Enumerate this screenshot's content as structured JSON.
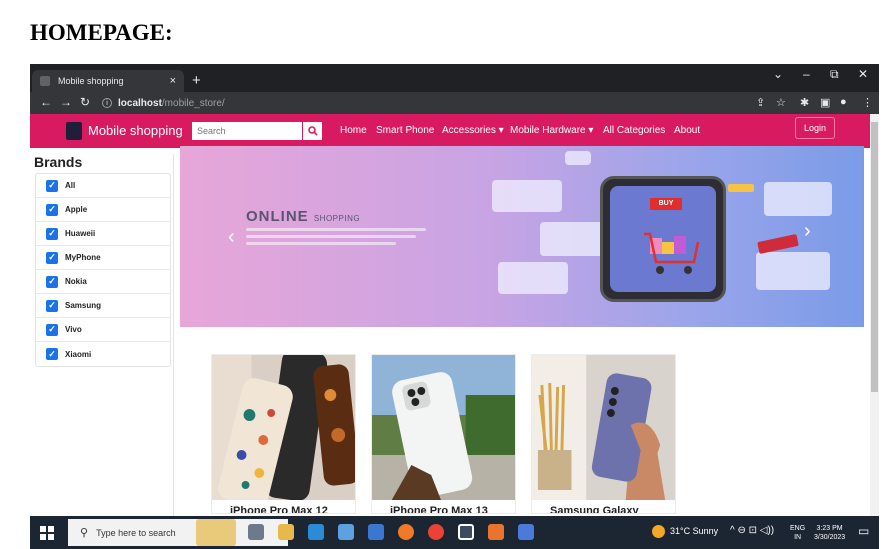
{
  "doc_heading": "HOMEPAGE:",
  "browser": {
    "tab_title": "Mobile shopping",
    "tab_close": "×",
    "new_tab": "+",
    "url_host": "localhost",
    "url_path": "/mobile_store/",
    "window_controls": [
      "⌄",
      "–",
      "⧉",
      "✕"
    ]
  },
  "navbar": {
    "brand": "Mobile shopping",
    "search_placeholder": "Search",
    "links": {
      "home": "Home",
      "smart_phone": "Smart Phone",
      "accessories": "Accessories ▾",
      "mobile_hardware": "Mobile Hardware ▾",
      "all_categories": "All Categories",
      "about": "About"
    },
    "login": "Login",
    "colors": {
      "navbar_bg": "#d81b60",
      "checkbox": "#1a73e8"
    }
  },
  "sidebar": {
    "title": "Brands",
    "brands": [
      "All",
      "Apple",
      "Huaweii",
      "MyPhone",
      "Nokia",
      "Samsung",
      "Vivo",
      "Xiaomi"
    ]
  },
  "carousel": {
    "headline": "ONLINE",
    "headline_small": "SHOPPING",
    "buy_tag": "BUY",
    "prev": "‹",
    "next": "›"
  },
  "products": [
    {
      "name": "iPhone Pro Max 12"
    },
    {
      "name": "iPhone Pro Max 13"
    },
    {
      "name": "Samsung Galaxy"
    }
  ],
  "taskbar": {
    "search_placeholder": "Type here to search",
    "weather": "31°C  Sunny",
    "lang": "ENG",
    "region": "IN",
    "time": "3:23 PM",
    "date": "3/30/2023"
  }
}
